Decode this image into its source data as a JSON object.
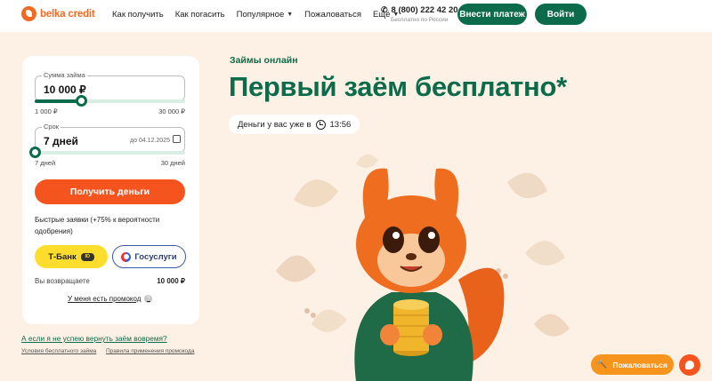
{
  "header": {
    "logo_text": "belka credit",
    "nav": [
      {
        "label": "Как получить",
        "has_dropdown": false
      },
      {
        "label": "Как погасить",
        "has_dropdown": false
      },
      {
        "label": "Популярное",
        "has_dropdown": true
      },
      {
        "label": "Пожаловаться",
        "has_dropdown": false
      },
      {
        "label": "Ещё",
        "has_dropdown": true
      }
    ],
    "phone": "8 (800) 222 42 20",
    "phone_note": "Бесплатно по России",
    "pay_button": "Внести платеж",
    "login_button": "Войти"
  },
  "hero": {
    "eyebrow": "Займы онлайн",
    "title": "Первый заём бесплатно*",
    "timer_text": "Деньги у вас уже в",
    "timer_time": "13:56"
  },
  "calculator": {
    "amount_label": "Сумма займа",
    "amount_value": "10 000 ₽",
    "amount_min": "1 000 ₽",
    "amount_max": "30 000 ₽",
    "amount_fraction": 0.31,
    "term_label": "Срок",
    "term_value": "7 дней",
    "term_hint": "до 04.12.2025",
    "term_min": "7 дней",
    "term_max": "30 дней",
    "term_fraction": 0.0,
    "get_button": "Получить деньги",
    "fast_text": "Быстрые заявки (+75% к вероятности одобрения)",
    "tbank_label": "Т-Банк",
    "tbank_badge": "ID",
    "gosuslugi_label": "Госуслуги",
    "return_label": "Вы возвращаете",
    "return_value": "10 000 ₽",
    "promo_link": "У меня есть промокод",
    "promo_help": "?"
  },
  "footer_links": {
    "late_question": "А если я не успею вернуть заём вовремя?",
    "free_terms": "Условия бесплатного займа",
    "promo_rules": "Правила применения промокода"
  },
  "floating": {
    "complain_button": "Пожаловаться"
  },
  "colors": {
    "brand_green": "#0b6b4a",
    "brand_orange": "#f5541e",
    "tbank_yellow": "#ffdd2d",
    "background": "#fdf1e6"
  },
  "icons": [
    "phone-icon",
    "clock-icon",
    "calendar-icon",
    "chevron-down-icon",
    "hammer-icon",
    "chat-icon",
    "help-icon"
  ]
}
